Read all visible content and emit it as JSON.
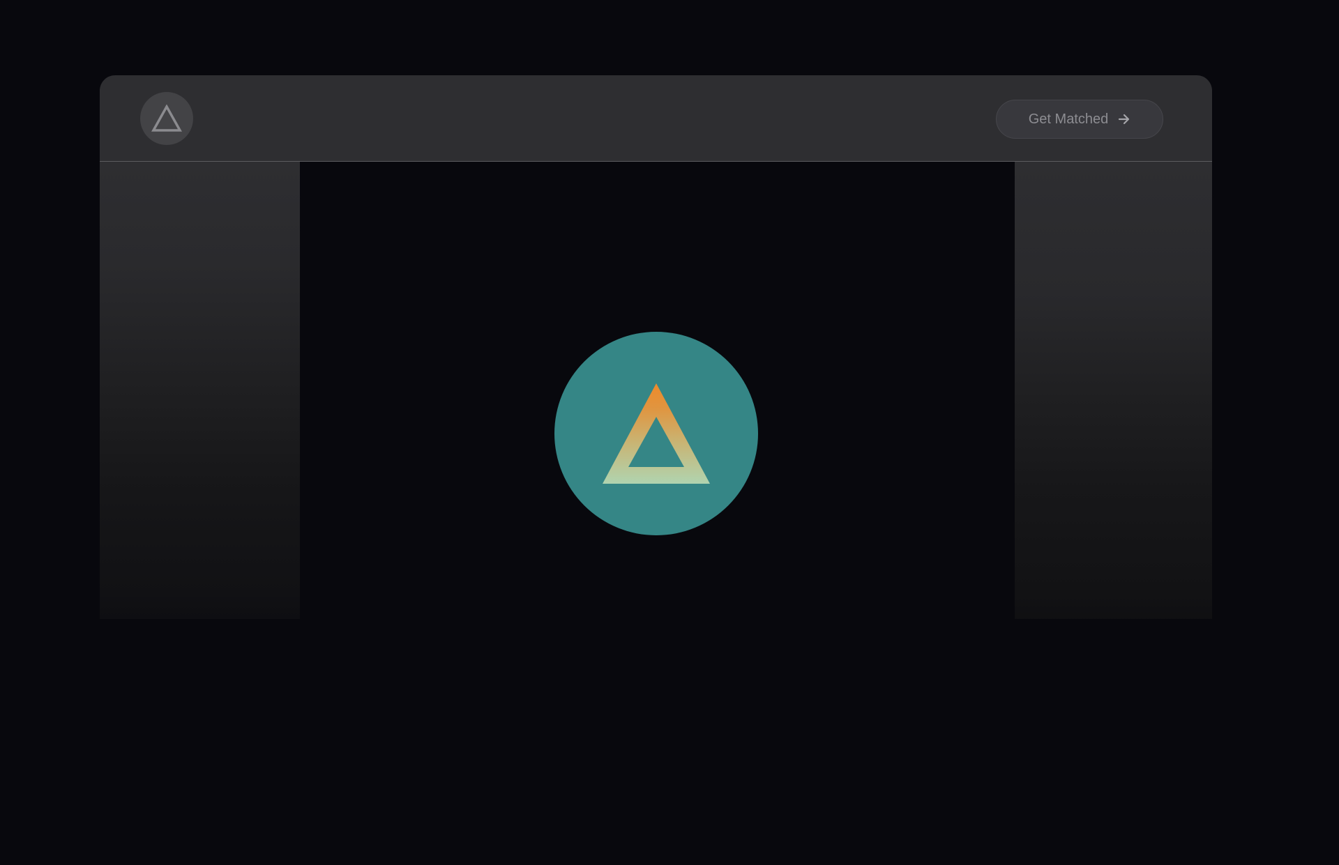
{
  "header": {
    "logo_icon": "triangle-logo-icon",
    "cta": {
      "label": "Get Matched",
      "icon": "arrow-right-icon"
    }
  },
  "hero": {
    "badge_icon": "triangle-logo-icon"
  },
  "colors": {
    "page_background": "#08080d",
    "header_background": "#2e2e31",
    "badge_background": "#358686",
    "gradient_top": "#ee8a2a",
    "gradient_bottom": "#b0d4b0"
  }
}
